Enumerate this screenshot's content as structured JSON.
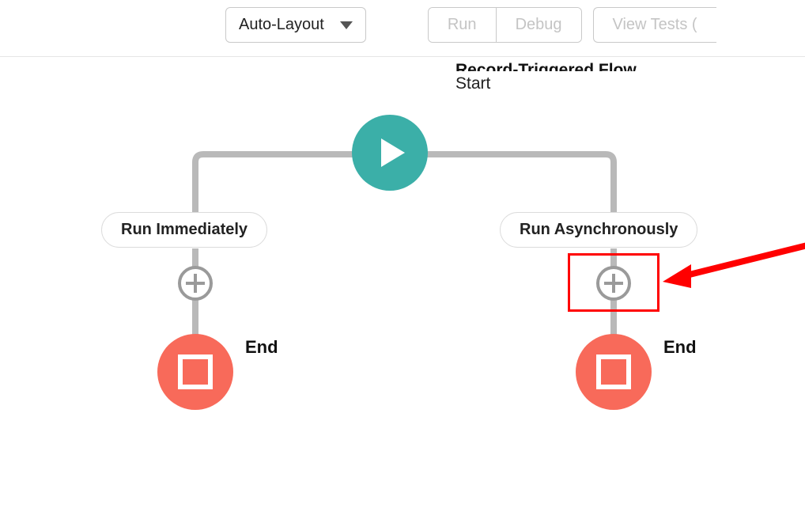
{
  "toolbar": {
    "layout_mode": "Auto-Layout",
    "run": "Run",
    "debug": "Debug",
    "view_tests": "View Tests ("
  },
  "header": {
    "title_partial": "Record-Triggered Flow",
    "sub": "Start"
  },
  "flow": {
    "branch_left": {
      "label": "Run Immediately",
      "end": "End"
    },
    "branch_right": {
      "label": "Run Asynchronously",
      "end": "End"
    }
  }
}
